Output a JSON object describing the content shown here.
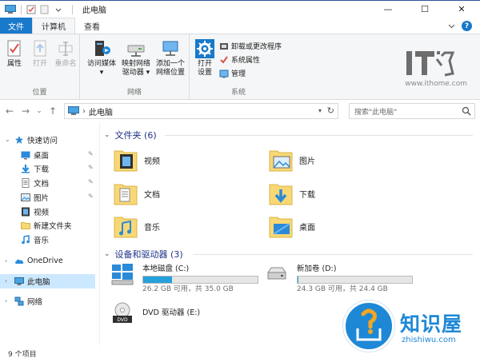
{
  "window": {
    "title": "此电脑",
    "controls": {
      "minimize": "—",
      "maximize": "☐",
      "close": "✕"
    }
  },
  "ribbon": {
    "tabs": [
      {
        "label": "文件"
      },
      {
        "label": "计算机"
      },
      {
        "label": "查看"
      }
    ],
    "groups": {
      "location": {
        "label": "位置",
        "buttons": [
          {
            "label": "属性"
          },
          {
            "label": "打开"
          },
          {
            "label": "重命名"
          }
        ]
      },
      "network": {
        "label": "网络",
        "buttons": [
          {
            "label_line1": "访问媒体",
            "label_line2": "▾"
          },
          {
            "label_line1": "映射网络",
            "label_line2": "驱动器 ▾"
          },
          {
            "label_line1": "添加一个",
            "label_line2": "网络位置"
          }
        ]
      },
      "system": {
        "label": "系统",
        "open_settings": {
          "label_line1": "打开",
          "label_line2": "设置"
        },
        "small": [
          {
            "label": "卸载或更改程序"
          },
          {
            "label": "系统属性"
          },
          {
            "label": "管理"
          }
        ]
      }
    },
    "watermark_url": "www.ithome.com"
  },
  "address": {
    "back": "←",
    "forward": "→",
    "recent": "⌄",
    "up": "↑",
    "path": "此电脑",
    "separator": "›",
    "refresh": "↻",
    "search_placeholder": "搜索\"此电脑\""
  },
  "nav": {
    "quick_access": "快速访问",
    "items": [
      {
        "label": "桌面",
        "pinned": true
      },
      {
        "label": "下载",
        "pinned": true
      },
      {
        "label": "文档",
        "pinned": true
      },
      {
        "label": "图片",
        "pinned": true
      },
      {
        "label": "视频",
        "pinned": false
      },
      {
        "label": "新建文件夹",
        "pinned": false
      },
      {
        "label": "音乐",
        "pinned": false
      }
    ],
    "onedrive": "OneDrive",
    "this_pc": "此电脑",
    "network": "网络"
  },
  "content": {
    "folders_header": "文件夹 (6)",
    "folders": [
      {
        "name": "视频"
      },
      {
        "name": "图片"
      },
      {
        "name": "文档"
      },
      {
        "name": "下载"
      },
      {
        "name": "音乐"
      },
      {
        "name": "桌面"
      }
    ],
    "drives_header": "设备和驱动器 (3)",
    "drives": [
      {
        "name": "本地磁盘 (C:)",
        "free": "26.2 GB 可用，共 35.0 GB",
        "used_fraction": 0.25
      },
      {
        "name": "新加卷 (D:)",
        "free": "24.3 GB 可用，共 24.4 GB",
        "used_fraction": 0.005
      },
      {
        "name": "DVD 驱动器 (E:)"
      }
    ]
  },
  "status": {
    "count": "9 个项目"
  },
  "badge": {
    "text": "知识屋",
    "url": "zhishiwu.com"
  },
  "colors": {
    "accent": "#1979ca",
    "folder": "#f8d775",
    "selection": "#cce8ff",
    "drive_bar": "#26a0da"
  }
}
